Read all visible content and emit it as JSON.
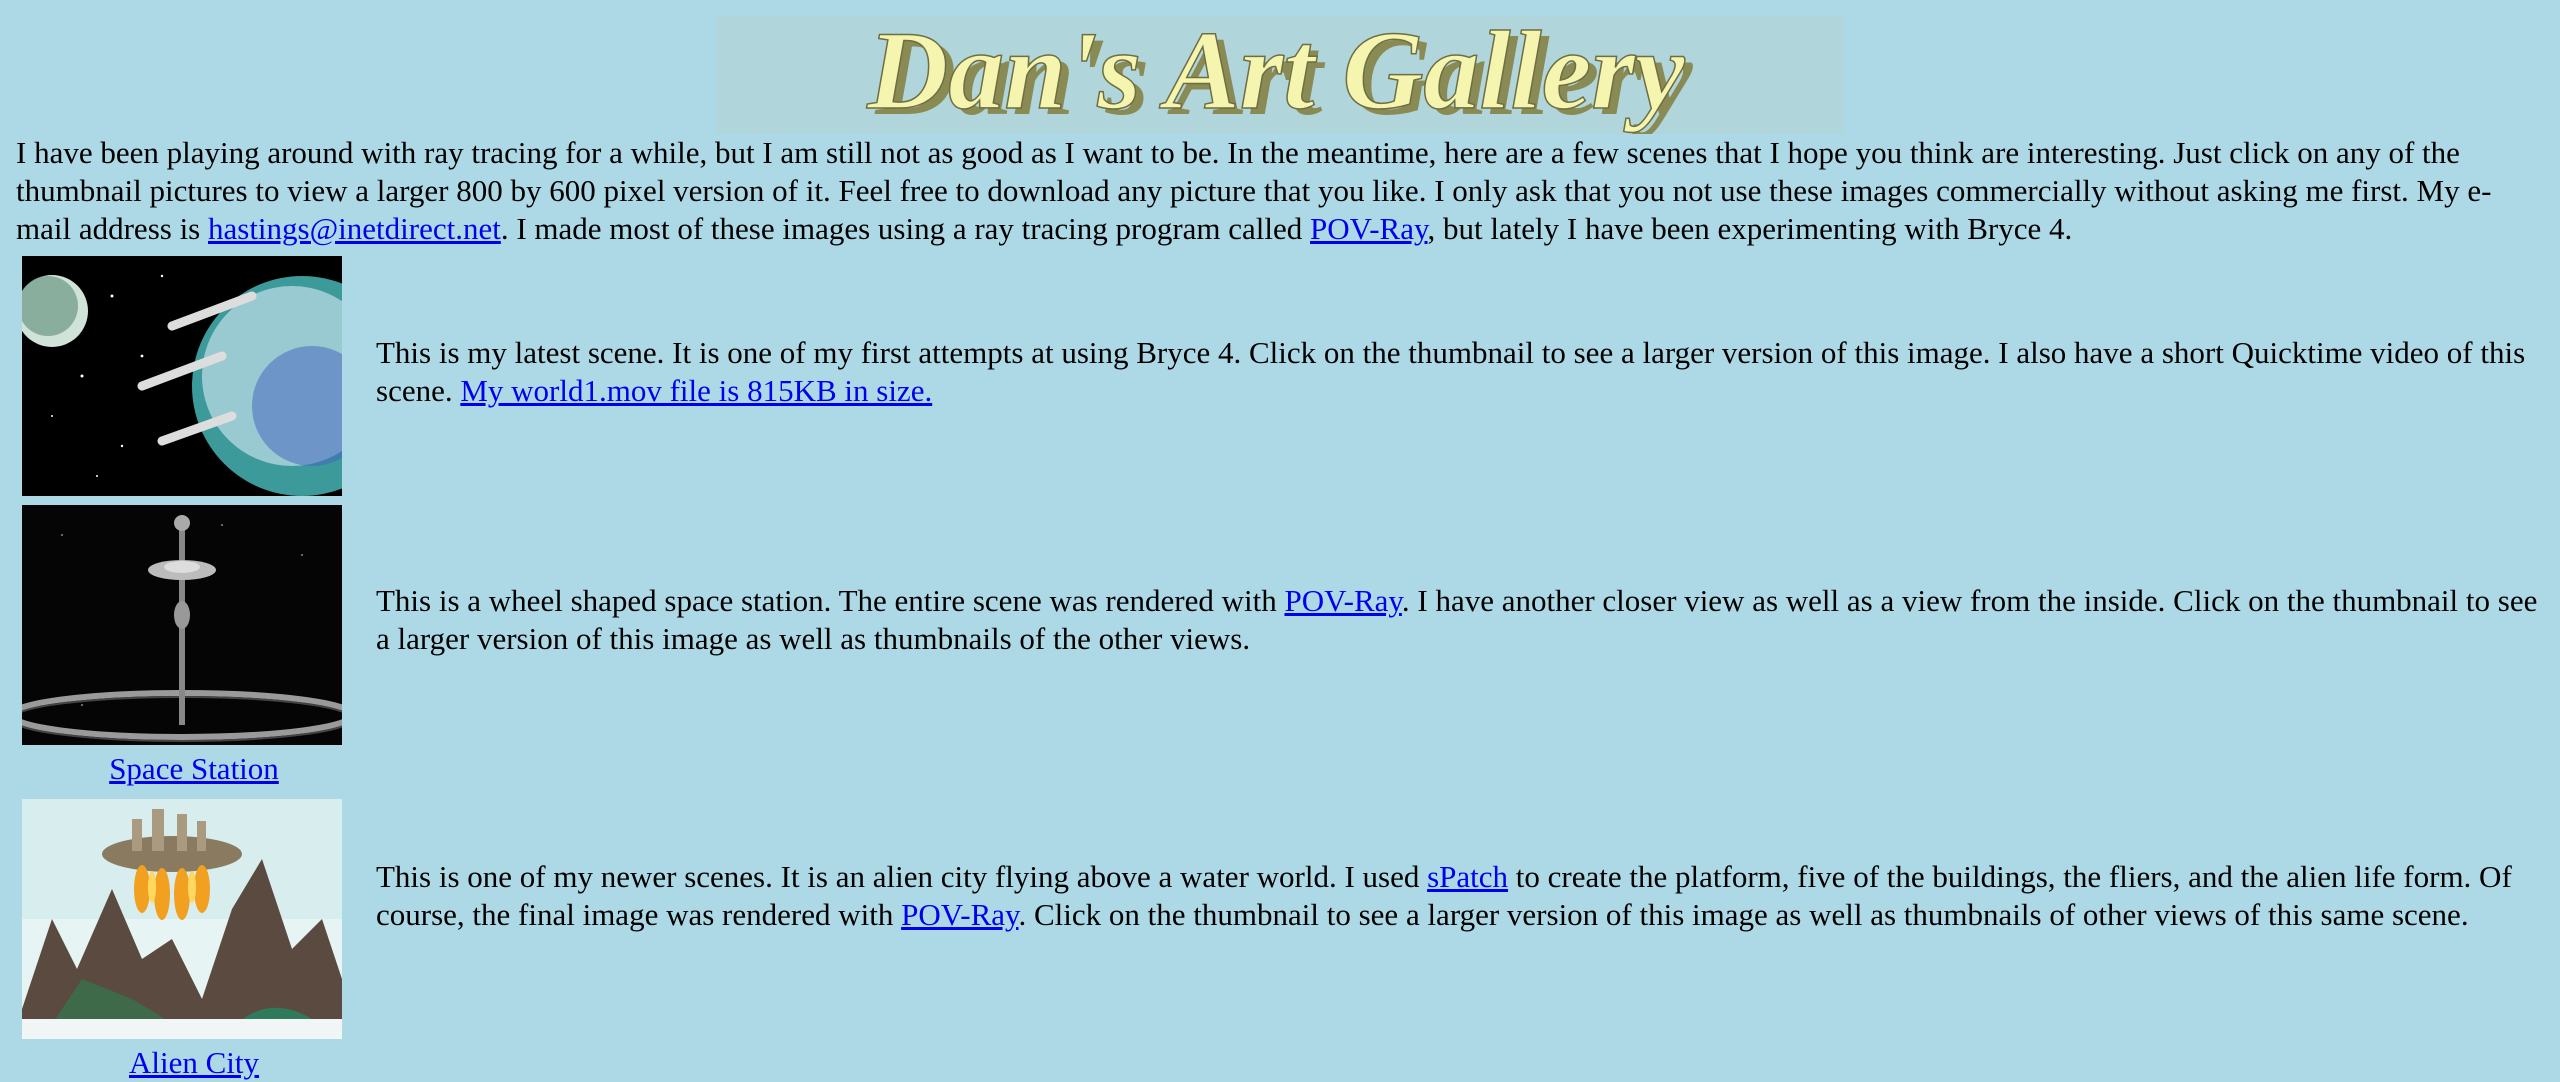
{
  "page": {
    "background": "#add8e6",
    "link_color": "#0000ee"
  },
  "banner": {
    "text": "Dan's Art Gallery",
    "fill": "#f5f5b0",
    "shade": "#8a8a55"
  },
  "intro": {
    "part1": "I have been playing around with ray tracing for a while, but I am still not as good as I want to be. In the meantime, here are a few scenes that I hope you think are interesting. Just click on any of the thumbnail pictures to view a larger 800 by 600 pixel version of it. Feel free to download any picture that you like. I only ask that you not use these images commercially without asking me first. My e-mail address is ",
    "email_link": "hastings@inetdirect.net",
    "part2": ". I made most of these images using a ray tracing program called ",
    "povray_link": "POV-Ray",
    "part3": ", but lately I have been experimenting with Bryce 4."
  },
  "entries": [
    {
      "thumbnail_icon": "space-planet-thumbnail",
      "desc_part1": "This is my latest scene. It is one of my first attempts at using Bryce 4. Click on the thumbnail to see a larger version of this image. I also have a short Quicktime video of this scene. ",
      "desc_link": "My world1.mov file is 815KB in size."
    },
    {
      "thumbnail_icon": "space-station-thumbnail",
      "caption": "Space Station",
      "desc_part1": "This is a wheel shaped space station. The entire scene was rendered with ",
      "desc_link": "POV-Ray",
      "desc_part2": ". I have another closer view as well as a view from the inside. Click on the thumbnail to see a larger version of this image as well as thumbnails of the other views."
    },
    {
      "thumbnail_icon": "alien-city-thumbnail",
      "caption": "Alien City",
      "desc_part1": "This is one of my newer scenes. It is an alien city flying above a water world. I used ",
      "desc_link": "sPatch",
      "desc_part2": " to create the platform, five of the buildings, the fliers, and the alien life form. Of course, the final image was rendered with ",
      "desc_link2": "POV-Ray",
      "desc_part3": ". Click on the thumbnail to see a larger version of this image as well as thumbnails of other views of this same scene."
    }
  ]
}
